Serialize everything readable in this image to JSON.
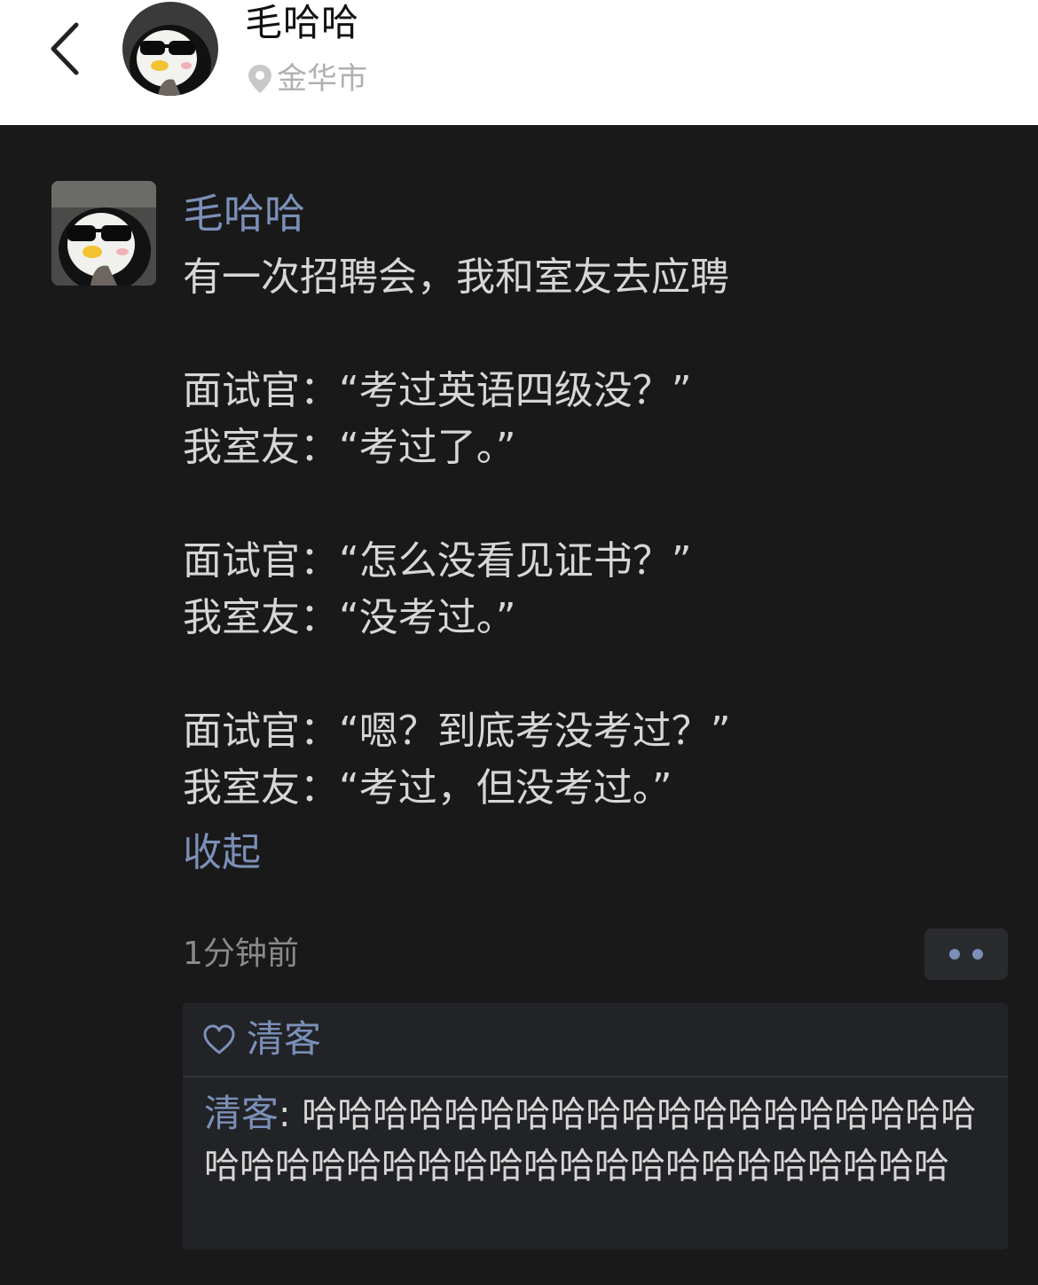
{
  "header": {
    "name": "毛哈哈",
    "location": "金华市"
  },
  "post": {
    "author": "毛哈哈",
    "lines": [
      "有一次招聘会，我和室友去应聘",
      "",
      "面试官：“考过英语四级没？”",
      "我室友：“考过了。”",
      "",
      "面试官：“怎么没看见证书？”",
      "我室友：“没考过。”",
      "",
      "面试官：“嗯？到底考没考过？”",
      "我室友：“考过，但没考过。”"
    ],
    "collapse_label": "收起",
    "time": "1分钟前"
  },
  "likes": {
    "names": "清客"
  },
  "comments": [
    {
      "author": "清客",
      "separator": ": ",
      "text": "哈哈哈哈哈哈哈哈哈哈哈哈哈哈哈哈哈哈哈哈哈哈哈哈哈哈哈哈哈哈哈哈哈哈哈哈哈哈哈哈"
    }
  ],
  "colors": {
    "link": "#7b90b8",
    "background": "#191919",
    "text": "#d6d6d6"
  }
}
